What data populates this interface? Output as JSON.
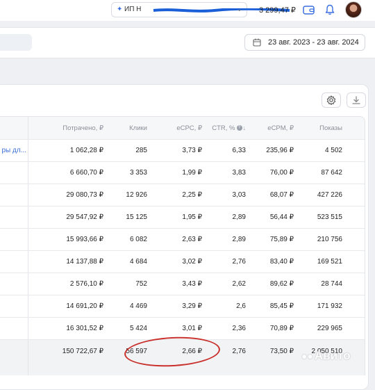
{
  "topbar": {
    "account_name": "ИП Н",
    "balance": "3 299,47 ₽"
  },
  "filters": {
    "date_range": "23 авг. 2023 - 23 авг. 2024"
  },
  "table": {
    "columns": [
      "Потрачено, ₽",
      "Клики",
      "eCPC, ₽",
      "CTR, %",
      "eCPM, ₽",
      "Показы"
    ],
    "rows": [
      {
        "name": "ры дл...",
        "spent": "1 062,28 ₽",
        "clicks": "285",
        "ecpc": "3,73 ₽",
        "ctr": "6,33",
        "ecpm": "235,96 ₽",
        "shows": "4 502"
      },
      {
        "name": "",
        "spent": "6 660,70 ₽",
        "clicks": "3 353",
        "ecpc": "1,99 ₽",
        "ctr": "3,83",
        "ecpm": "76,00 ₽",
        "shows": "87 642"
      },
      {
        "name": "",
        "spent": "29 080,73 ₽",
        "clicks": "12 926",
        "ecpc": "2,25 ₽",
        "ctr": "3,03",
        "ecpm": "68,07 ₽",
        "shows": "427 226"
      },
      {
        "name": "",
        "spent": "29 547,92 ₽",
        "clicks": "15 125",
        "ecpc": "1,95 ₽",
        "ctr": "2,89",
        "ecpm": "56,44 ₽",
        "shows": "523 515"
      },
      {
        "name": "",
        "spent": "15 993,66 ₽",
        "clicks": "6 082",
        "ecpc": "2,63 ₽",
        "ctr": "2,89",
        "ecpm": "75,89 ₽",
        "shows": "210 756"
      },
      {
        "name": "",
        "spent": "14 137,88 ₽",
        "clicks": "4 684",
        "ecpc": "3,02 ₽",
        "ctr": "2,76",
        "ecpm": "83,40 ₽",
        "shows": "169 521"
      },
      {
        "name": "",
        "spent": "2 576,10 ₽",
        "clicks": "752",
        "ecpc": "3,43 ₽",
        "ctr": "2,62",
        "ecpm": "89,62 ₽",
        "shows": "28 744"
      },
      {
        "name": "",
        "spent": "14 691,20 ₽",
        "clicks": "4 469",
        "ecpc": "3,29 ₽",
        "ctr": "2,6",
        "ecpm": "85,45 ₽",
        "shows": "171 932"
      },
      {
        "name": "",
        "spent": "16 301,52 ₽",
        "clicks": "5 424",
        "ecpc": "3,01 ₽",
        "ctr": "2,36",
        "ecpm": "70,89 ₽",
        "shows": "229 965"
      }
    ],
    "total": {
      "spent": "150 722,67 ₽",
      "clicks": "56 597",
      "ecpc": "2,66 ₽",
      "ctr": "2,76",
      "ecpm": "73,50 ₽",
      "shows": "2 050 510"
    }
  },
  "watermark": "Авито",
  "colors": {
    "accent": "#3a6fe0",
    "annotation": "#c9302c"
  }
}
